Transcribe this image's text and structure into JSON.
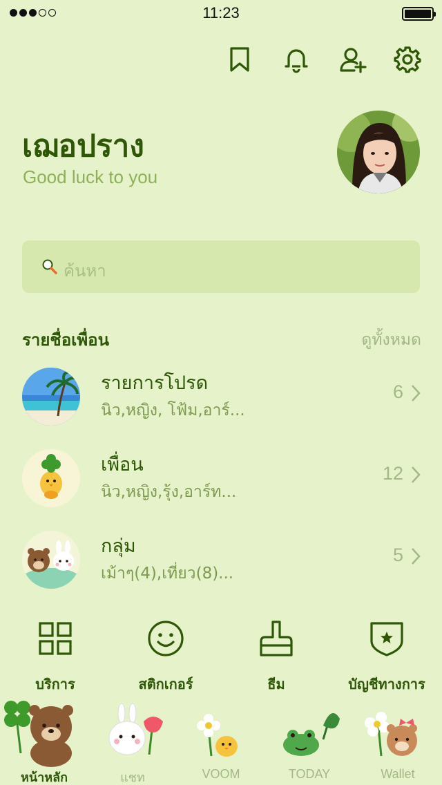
{
  "status_bar": {
    "time": "11:23"
  },
  "colors": {
    "background": "#e6f2c9",
    "primary_text": "#2f5708",
    "secondary_text": "#8fb05b",
    "muted": "#a3b887",
    "search_bg": "#d6e8ad"
  },
  "top_icons": [
    "bookmark-icon",
    "bell-icon",
    "add-friend-icon",
    "gear-icon"
  ],
  "profile": {
    "name": "เฌอปราง",
    "status_message": "Good luck to you"
  },
  "search": {
    "placeholder": "ค้นหา"
  },
  "friends_section": {
    "title": "รายชื่อเพื่อน",
    "see_all": "ดูทั้งหมด",
    "rows": [
      {
        "title": "รายการโปรด",
        "subtitle": "นิว,หญิง, โฟ้ม,อาร์...",
        "count": "6"
      },
      {
        "title": "เพื่อน",
        "subtitle": "นิว,หญิง,รุ้ง,อาร์ท...",
        "count": "12"
      },
      {
        "title": "กลุ่ม",
        "subtitle": "เม้าๆ(4),เที่ยว(8)...",
        "count": "5"
      }
    ]
  },
  "quick_actions": [
    {
      "label": "บริการ",
      "icon": "grid-icon"
    },
    {
      "label": "สติกเกอร์",
      "icon": "smiley-icon"
    },
    {
      "label": "ธีม",
      "icon": "brush-icon"
    },
    {
      "label": "บัญชีทางการ",
      "icon": "shield-star-icon"
    }
  ],
  "tabs": [
    {
      "label": "หน้าหลัก",
      "active": true
    },
    {
      "label": "แชท",
      "active": false
    },
    {
      "label": "VOOM",
      "active": false
    },
    {
      "label": "TODAY",
      "active": false
    },
    {
      "label": "Wallet",
      "active": false
    }
  ]
}
